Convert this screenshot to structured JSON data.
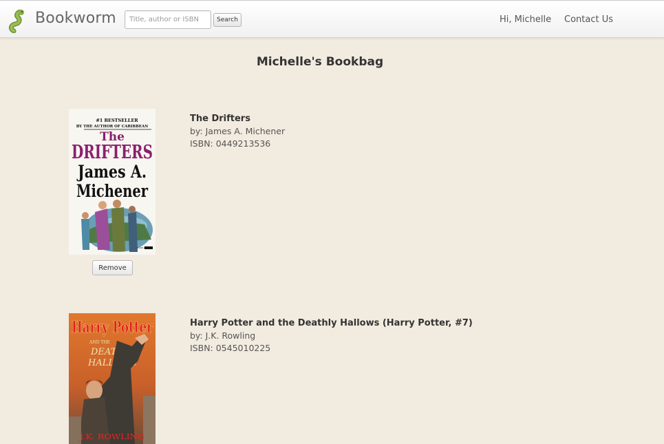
{
  "header": {
    "brand": "Bookworm",
    "logo_icon": "worm-icon",
    "search": {
      "placeholder": "Title, author or ISBN",
      "value": ""
    },
    "search_button": "Search",
    "greeting": "Hi, Michelle",
    "contact": "Contact Us"
  },
  "page": {
    "title": "Michelle's Bookbag"
  },
  "books": [
    {
      "title": "The Drifters",
      "author_line": "by: James A. Michener",
      "isbn_line": "ISBN: 0449213536",
      "cover": {
        "top_line_1": "#1 BESTSELLER",
        "top_line_2": "BY THE AUTHOR OF CARIBBEAN",
        "title_1": "The",
        "title_2": "DRIFTERS",
        "author_1": "James A.",
        "author_2": "Michener"
      },
      "remove_label": "Remove"
    },
    {
      "title": "Harry Potter and the Deathly Hallows (Harry Potter, #7)",
      "author_line": "by: J.K. Rowling",
      "isbn_line": "ISBN: 0545010225",
      "cover": {
        "title_1": "Harry Potter",
        "subtitle_1": "AND THE",
        "subtitle_2": "DEATHLY",
        "subtitle_3": "HALLOWS",
        "author": "J.K. ROWLING"
      }
    }
  ],
  "colors": {
    "page_background": "#f2ebe0",
    "drifters_title": "#8b1f6e",
    "hp_cover": "#d46a29"
  }
}
